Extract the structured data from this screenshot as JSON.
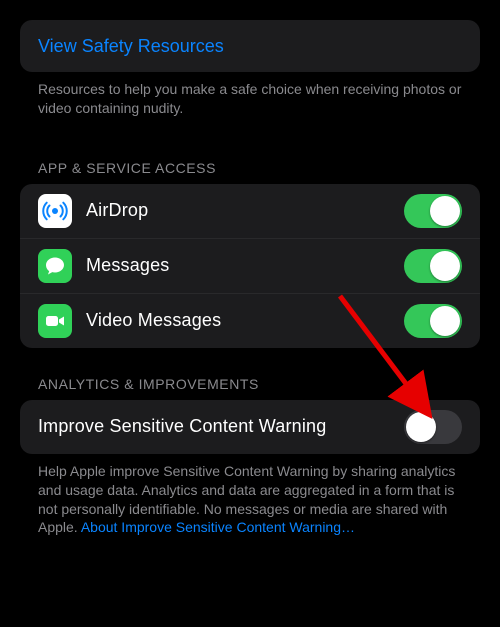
{
  "resources": {
    "link_label": "View Safety Resources",
    "footer": "Resources to help you make a safe choice when receiving photos or video containing nudity."
  },
  "app_access": {
    "header": "APP & SERVICE ACCESS",
    "items": [
      {
        "label": "AirDrop",
        "on": true
      },
      {
        "label": "Messages",
        "on": true
      },
      {
        "label": "Video Messages",
        "on": true
      }
    ]
  },
  "analytics": {
    "header": "ANALYTICS & IMPROVEMENTS",
    "item_label": "Improve Sensitive Content Warning",
    "on": false,
    "footer_text": "Help Apple improve Sensitive Content Warning by sharing analytics and usage data. Analytics and data are aggregated in a form that is not personally identifiable. No messages or media are shared with Apple. ",
    "footer_link": "About Improve Sensitive Content Warning…"
  }
}
